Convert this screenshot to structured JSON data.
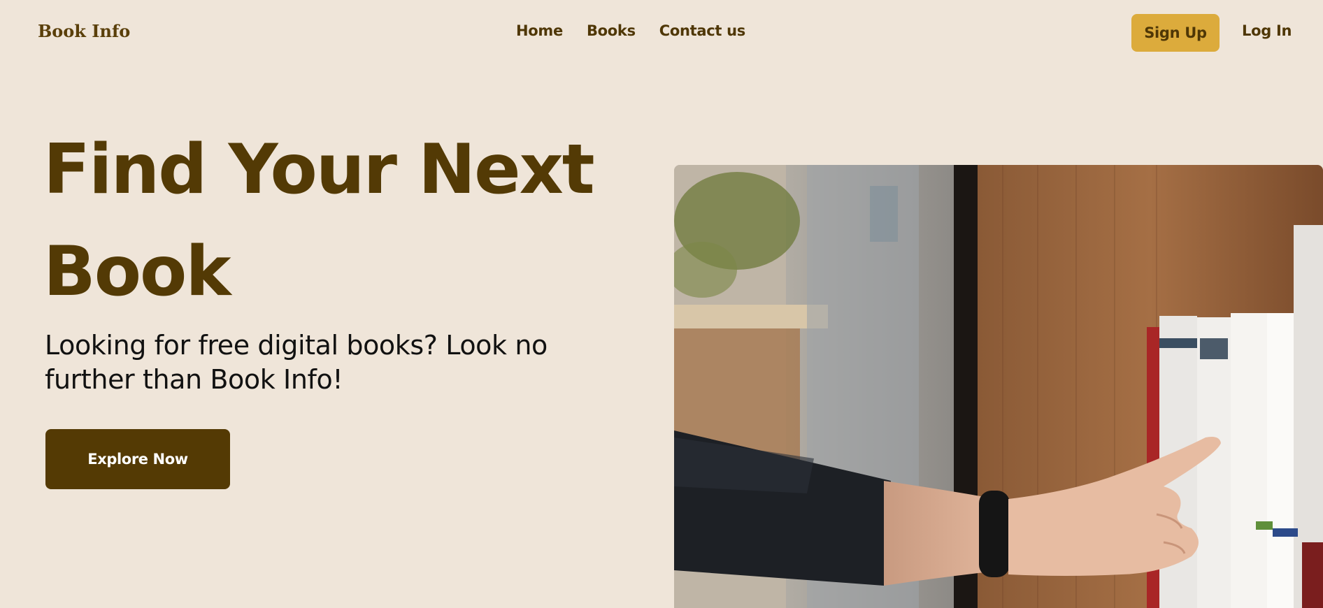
{
  "nav": {
    "brand": "Book Info",
    "links": [
      "Home",
      "Books",
      "Contact us"
    ],
    "signup_label": "Sign Up",
    "login_label": "Log In"
  },
  "hero": {
    "title_line1": "Find Your Next",
    "title_line2": "Book",
    "subtitle": "Looking for free digital books? Look no further than Book Info!",
    "cta_label": "Explore Now"
  },
  "colors": {
    "background": "#efe5d9",
    "brand_brown": "#533a05",
    "accent_gold": "#dcab3c"
  }
}
